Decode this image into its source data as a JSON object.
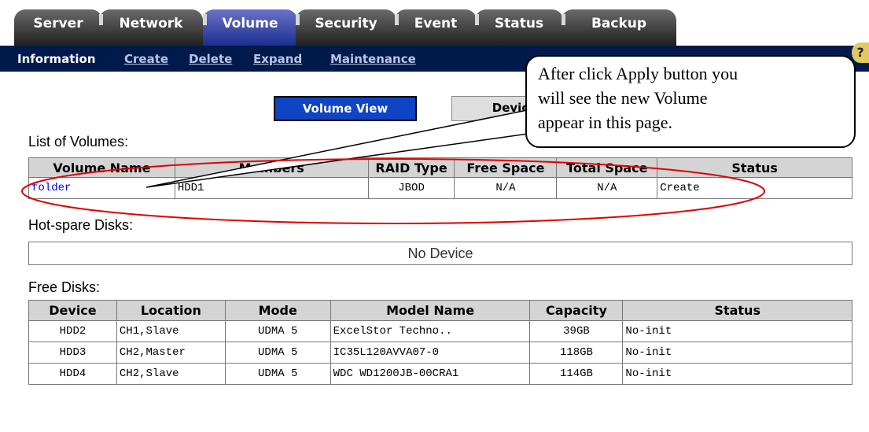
{
  "tabs": [
    {
      "label": "Server",
      "active": false
    },
    {
      "label": "Network",
      "active": false
    },
    {
      "label": "Volume",
      "active": true
    },
    {
      "label": "Security",
      "active": false
    },
    {
      "label": "Event",
      "active": false
    },
    {
      "label": "Status",
      "active": false
    },
    {
      "label": "Backup",
      "active": false
    }
  ],
  "subnav": [
    "Information",
    "Create",
    "Delete",
    "Expand",
    "Maintenance"
  ],
  "help_label": "?",
  "view_buttons": {
    "volume_view": "Volume View",
    "device_view": "Devic"
  },
  "volumes": {
    "title": "List of Volumes:",
    "headers": [
      "Volume Name",
      "Members",
      "RAID Type",
      "Free Space",
      "Total Space",
      "Status"
    ],
    "rows": [
      [
        "folder",
        "HDD1",
        "JBOD",
        "N/A",
        "N/A",
        "Create"
      ]
    ]
  },
  "hotspare": {
    "title": "Hot-spare Disks:",
    "empty_text": "No Device"
  },
  "free_disks": {
    "title": "Free Disks:",
    "headers": [
      "Device",
      "Location",
      "Mode",
      "Model Name",
      "Capacity",
      "Status"
    ],
    "rows": [
      [
        "HDD2",
        "CH1,Slave",
        "UDMA 5",
        "ExcelStor Techno..",
        "39GB",
        "No-init"
      ],
      [
        "HDD3",
        "CH2,Master",
        "UDMA 5",
        "IC35L120AVVA07-0",
        "118GB",
        "No-init"
      ],
      [
        "HDD4",
        "CH2,Slave",
        "UDMA 5",
        "WDC WD1200JB-00CRA1",
        "114GB",
        "No-init"
      ]
    ]
  },
  "callout": {
    "lines": [
      "After click Apply button you",
      "will see the new Volume",
      "appear in this page."
    ]
  },
  "colors": {
    "nav_bg": "#001a4c",
    "active_tab": "#1c2f8f",
    "button_blue": "#0f44c4",
    "highlight_ring": "#e00000"
  }
}
